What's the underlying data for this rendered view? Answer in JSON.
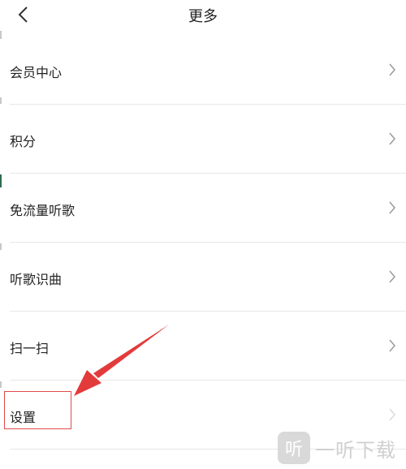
{
  "header": {
    "back_icon": "chevron-left-icon",
    "title": "更多"
  },
  "menu": {
    "items": [
      {
        "label": "会员中心",
        "icon": "chevron-right-icon"
      },
      {
        "label": "积分",
        "icon": "chevron-right-icon"
      },
      {
        "label": "免流量听歌",
        "icon": "chevron-right-icon"
      },
      {
        "label": "听歌识曲",
        "icon": "chevron-right-icon"
      },
      {
        "label": "扫一扫",
        "icon": "chevron-right-icon"
      },
      {
        "label": "设置",
        "icon": "chevron-right-icon"
      }
    ]
  },
  "annotation": {
    "highlight_color": "#e14b4b",
    "arrow_color": "#e33b3b"
  },
  "watermark": {
    "logo_glyph": "听",
    "text": "一听下载"
  }
}
